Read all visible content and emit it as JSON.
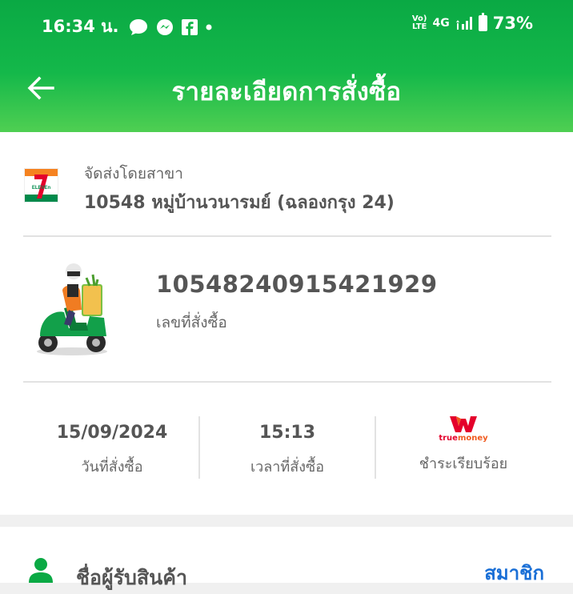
{
  "status_bar": {
    "time": "16:34 น.",
    "network": "4G",
    "volte": "Vo) LTE",
    "battery": "73%"
  },
  "header": {
    "title": "รายละเอียดการสั่งซื้อ"
  },
  "branch": {
    "caption": "จัดส่งโดยสาขา",
    "name": "10548 หมู่บ้านวนารมย์ (ฉลองกรุง 24)"
  },
  "order": {
    "number": "10548240915421929",
    "caption": "เลขที่สั่งซื้อ"
  },
  "info": {
    "date": "15/09/2024",
    "date_label": "วันที่สั่งซื้อ",
    "time": "15:13",
    "time_label": "เวลาที่สั่งซื้อ",
    "payment_label": "ชำระเรียบร้อย",
    "payment_logo_text": "truemoney"
  },
  "receiver": {
    "title": "ชื่อผู้รับสินค้า",
    "member_link": "สมาชิก"
  },
  "colors": {
    "brand_green": "#0aa944",
    "link_blue": "#1a6fd6",
    "truemoney_orange": "#f05a1e",
    "truemoney_red": "#e4002b"
  },
  "icons": [
    "chat-bubble-icon",
    "messenger-icon",
    "facebook-icon",
    "signal-icon",
    "battery-icon",
    "back-arrow-icon",
    "seven-eleven-logo",
    "delivery-rider-illustration",
    "truemoney-logo",
    "person-icon"
  ]
}
